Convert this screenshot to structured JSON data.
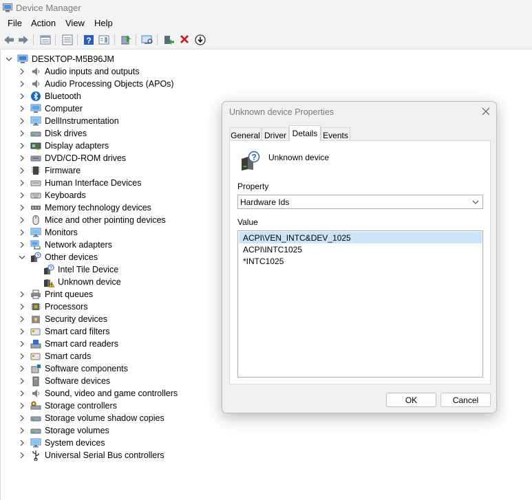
{
  "window": {
    "title": "Device Manager"
  },
  "menu": [
    "File",
    "Action",
    "View",
    "Help"
  ],
  "toolbar": {
    "buttons": [
      "back-arrow-icon",
      "forward-arrow-icon",
      "properties-list-icon",
      "show-hide-console-tree-icon",
      "help-icon",
      "action-pane-icon",
      "update-driver-icon",
      "scan-hardware-icon",
      "enable-device-icon",
      "uninstall-icon",
      "download-icon"
    ]
  },
  "tree": {
    "root": "DESKTOP-M5B96JM",
    "categories": [
      {
        "label": "Audio inputs and outputs",
        "icon": "speaker-icon"
      },
      {
        "label": "Audio Processing Objects (APOs)",
        "icon": "speaker-icon"
      },
      {
        "label": "Bluetooth",
        "icon": "bluetooth-icon"
      },
      {
        "label": "Computer",
        "icon": "computer-icon"
      },
      {
        "label": "DellInstrumentation",
        "icon": "monitor-icon"
      },
      {
        "label": "Disk drives",
        "icon": "disk-drive-icon"
      },
      {
        "label": "Display adapters",
        "icon": "display-adapter-icon"
      },
      {
        "label": "DVD/CD-ROM drives",
        "icon": "dvd-drive-icon"
      },
      {
        "label": "Firmware",
        "icon": "firmware-icon"
      },
      {
        "label": "Human Interface Devices",
        "icon": "hid-icon"
      },
      {
        "label": "Keyboards",
        "icon": "keyboard-icon"
      },
      {
        "label": "Memory technology devices",
        "icon": "memory-icon"
      },
      {
        "label": "Mice and other pointing devices",
        "icon": "mouse-icon"
      },
      {
        "label": "Monitors",
        "icon": "monitor-icon"
      },
      {
        "label": "Network adapters",
        "icon": "network-icon"
      },
      {
        "label": "Other devices",
        "icon": "unknown-device-icon",
        "expanded": true,
        "children": [
          {
            "label": "Intel Tile Device",
            "icon": "unknown-device-icon"
          },
          {
            "label": "Unknown device",
            "icon": "warning-device-icon"
          }
        ]
      },
      {
        "label": "Print queues",
        "icon": "printer-icon"
      },
      {
        "label": "Processors",
        "icon": "processor-icon"
      },
      {
        "label": "Security devices",
        "icon": "security-icon"
      },
      {
        "label": "Smart card filters",
        "icon": "smart-card-icon"
      },
      {
        "label": "Smart card readers",
        "icon": "smart-card-reader-icon"
      },
      {
        "label": "Smart cards",
        "icon": "smart-card-icon"
      },
      {
        "label": "Software components",
        "icon": "software-component-icon"
      },
      {
        "label": "Software devices",
        "icon": "software-device-icon"
      },
      {
        "label": "Sound, video and game controllers",
        "icon": "speaker-icon"
      },
      {
        "label": "Storage controllers",
        "icon": "storage-controller-icon"
      },
      {
        "label": "Storage volume shadow copies",
        "icon": "disk-drive-icon"
      },
      {
        "label": "Storage volumes",
        "icon": "disk-drive-icon"
      },
      {
        "label": "System devices",
        "icon": "monitor-icon"
      },
      {
        "label": "Universal Serial Bus controllers",
        "icon": "usb-icon"
      }
    ]
  },
  "dialog": {
    "title": "Unknown device Properties",
    "tabs": [
      "General",
      "Driver",
      "Details",
      "Events"
    ],
    "active_tab": "Details",
    "device_name": "Unknown device",
    "property_label": "Property",
    "property_value": "Hardware Ids",
    "value_label": "Value",
    "values": [
      "ACPI\\VEN_INTC&DEV_1025",
      "ACPI\\INTC1025",
      "*INTC1025"
    ],
    "selected_value_index": 0,
    "ok_label": "OK",
    "cancel_label": "Cancel"
  },
  "colors": {
    "selection": "#cce4f7",
    "chrome": "#f3f3f3",
    "dialog_bg": "#f0f0f0",
    "uninstall_red": "#d01c1c",
    "windows_blue": "#0078d4"
  }
}
